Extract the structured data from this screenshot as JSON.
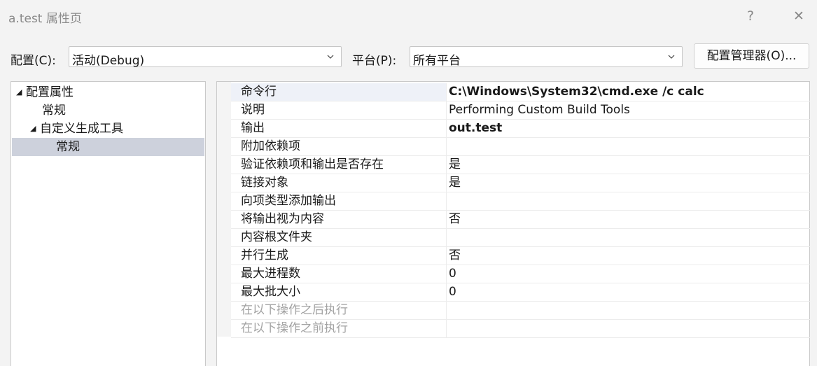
{
  "window": {
    "title": "a.test 属性页",
    "help_glyph": "?",
    "close_glyph": "✕"
  },
  "config": {
    "configuration_label": "配置(C):",
    "configuration_value": "活动(Debug)",
    "platform_label": "平台(P):",
    "platform_value": "所有平台",
    "manager_button": "配置管理器(O)..."
  },
  "tree": {
    "items": [
      {
        "label": "配置属性",
        "expander": "◢"
      },
      {
        "label": "常规"
      },
      {
        "label": "自定义生成工具",
        "expander": "◢"
      },
      {
        "label": "常规",
        "selected": true
      }
    ]
  },
  "properties": {
    "rows": [
      {
        "name": "命令行",
        "value": "C:\\Windows\\System32\\cmd.exe /c calc",
        "bold": true
      },
      {
        "name": "说明",
        "value": "Performing Custom Build Tools"
      },
      {
        "name": "输出",
        "value": "out.test",
        "bold": true
      },
      {
        "name": "附加依赖项",
        "value": ""
      },
      {
        "name": "验证依赖项和输出是否存在",
        "value": "是"
      },
      {
        "name": "链接对象",
        "value": "是"
      },
      {
        "name": "向项类型添加输出",
        "value": ""
      },
      {
        "name": "将输出视为内容",
        "value": "否"
      },
      {
        "name": "内容根文件夹",
        "value": ""
      },
      {
        "name": "并行生成",
        "value": "否"
      },
      {
        "name": "最大进程数",
        "value": "0"
      },
      {
        "name": "最大批大小",
        "value": "0"
      },
      {
        "name": "在以下操作之后执行",
        "value": "",
        "disabled": true
      },
      {
        "name": "在以下操作之前执行",
        "value": "",
        "disabled": true
      }
    ]
  },
  "colors": {
    "selection": "#cdd1dc",
    "disabled_text": "#a3a3a3",
    "title_text": "#8a8a8a"
  },
  "icons": {
    "combo_arrow": "chevron-down-icon",
    "expander": "expand-triangle-icon"
  }
}
